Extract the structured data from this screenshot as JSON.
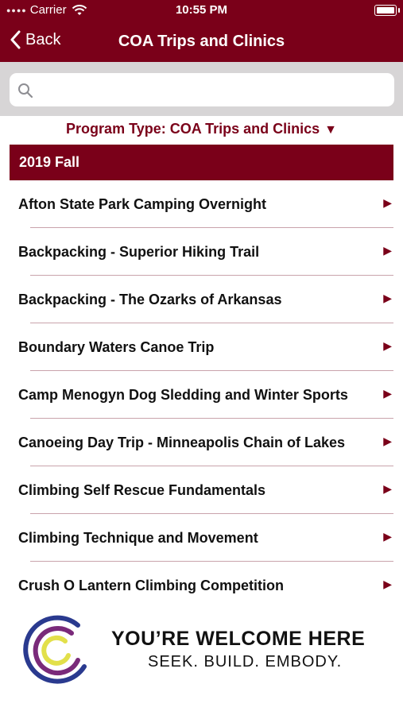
{
  "status_bar": {
    "carrier": "Carrier",
    "time": "10:55 PM"
  },
  "nav": {
    "back_label": "Back",
    "title": "COA Trips and Clinics"
  },
  "search": {
    "placeholder": "",
    "value": ""
  },
  "filter": {
    "label": "Program Type: COA Trips and Clinics",
    "caret": "▼"
  },
  "section": {
    "title": "2019 Fall"
  },
  "items": [
    {
      "label": "Afton State Park Camping Overnight"
    },
    {
      "label": "Backpacking - Superior Hiking Trail"
    },
    {
      "label": "Backpacking - The Ozarks of Arkansas"
    },
    {
      "label": "Boundary Waters Canoe Trip"
    },
    {
      "label": "Camp Menogyn Dog Sledding and Winter Sports"
    },
    {
      "label": "Canoeing Day Trip - Minneapolis Chain of Lakes"
    },
    {
      "label": "Climbing Self Rescue Fundamentals"
    },
    {
      "label": "Climbing Technique and Movement"
    },
    {
      "label": "Crush O Lantern Climbing Competition"
    }
  ],
  "chevron": "▶",
  "footer": {
    "title": "YOU’RE WELCOME HERE",
    "subtitle": "SEEK. BUILD. EMBODY."
  },
  "colors": {
    "brand": "#7a0019",
    "search_bg": "#d7d5d6",
    "divider": "#c9a3ab"
  }
}
